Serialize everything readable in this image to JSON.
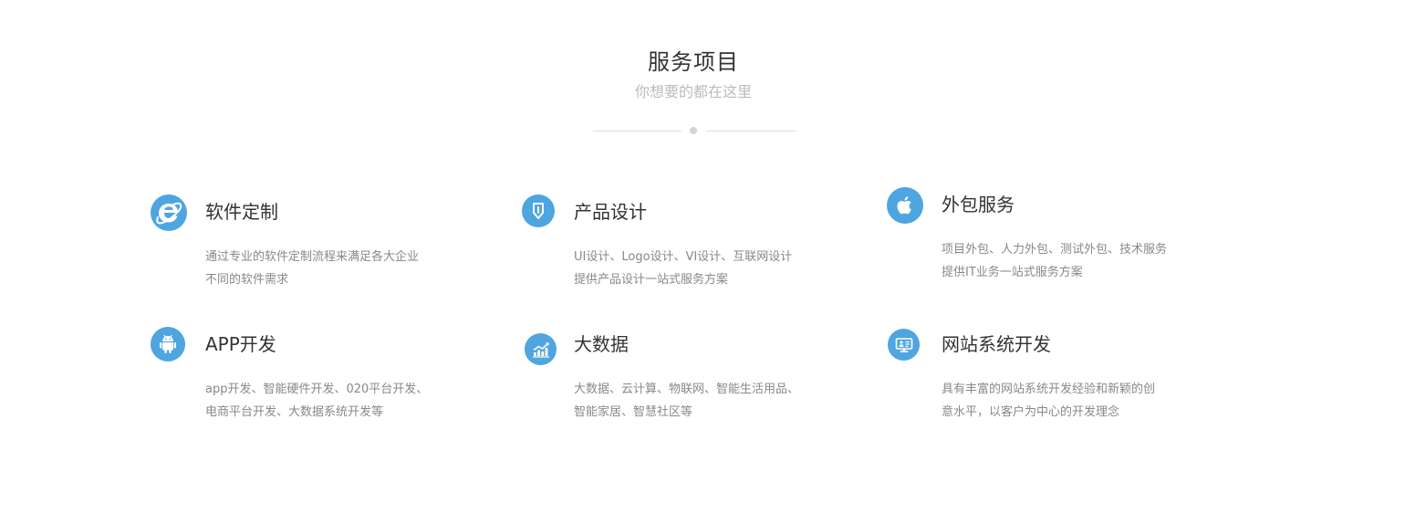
{
  "section": {
    "title": "服务项目",
    "subtitle": "你想要的都在这里"
  },
  "accent_color": "#4ea5e0",
  "services": [
    {
      "name": "软件定制",
      "icon": "ie-browser-icon",
      "desc": [
        "通过专业的软件定制流程来满足各大企业",
        "不同的软件需求"
      ]
    },
    {
      "name": "产品设计",
      "icon": "pen-nib-icon",
      "desc": [
        "UI设计、Logo设计、VI设计、互联网设计",
        "提供产品设计一站式服务方案"
      ]
    },
    {
      "name": "外包服务",
      "icon": "apple-icon",
      "desc": [
        "项目外包、人力外包、测试外包、技术服务",
        "提供IT业务一站式服务方案"
      ]
    },
    {
      "name": "APP开发",
      "icon": "android-icon",
      "desc": [
        "app开发、智能硬件开发、020平台开发、",
        "电商平台开发、大数据系统开发等"
      ]
    },
    {
      "name": "大数据",
      "icon": "chart-growth-icon",
      "desc": [
        "大数据、云计算、物联网、智能生活用品、",
        "智能家居、智慧社区等"
      ]
    },
    {
      "name": "网站系统开发",
      "icon": "monitor-icon",
      "desc": [
        "具有丰富的网站系统开发经验和新颖的创",
        "意水平，以客户为中心的开发理念"
      ]
    }
  ]
}
